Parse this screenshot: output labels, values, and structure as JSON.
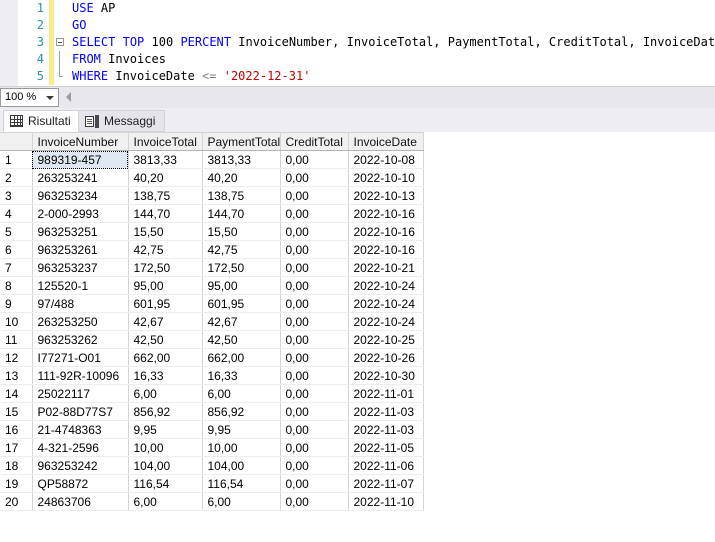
{
  "editor": {
    "zoom_level": "100 %",
    "lines": [
      {
        "number": "1",
        "tokens": [
          {
            "t": "USE",
            "c": "kw"
          },
          {
            "t": " ",
            "c": "punct"
          },
          {
            "t": "AP",
            "c": "id"
          }
        ]
      },
      {
        "number": "2",
        "tokens": [
          {
            "t": "GO",
            "c": "kw"
          }
        ]
      },
      {
        "number": "3",
        "tokens": [
          {
            "t": "SELECT",
            "c": "kw"
          },
          {
            "t": " ",
            "c": "punct"
          },
          {
            "t": "TOP",
            "c": "kw"
          },
          {
            "t": " ",
            "c": "punct"
          },
          {
            "t": "100",
            "c": "num"
          },
          {
            "t": " ",
            "c": "punct"
          },
          {
            "t": "PERCENT",
            "c": "kw"
          },
          {
            "t": " InvoiceNumber, InvoiceTotal, PaymentTotal, CreditTotal, InvoiceDate",
            "c": "id"
          }
        ]
      },
      {
        "number": "4",
        "tokens": [
          {
            "t": "FROM",
            "c": "kw"
          },
          {
            "t": " Invoices",
            "c": "id"
          }
        ]
      },
      {
        "number": "5",
        "tokens": [
          {
            "t": "WHERE",
            "c": "kw"
          },
          {
            "t": " InvoiceDate ",
            "c": "id"
          },
          {
            "t": "<=",
            "c": "op"
          },
          {
            "t": " ",
            "c": "punct"
          },
          {
            "t": "'2022-12-31'",
            "c": "str"
          }
        ]
      }
    ],
    "full_text": "USE AP\nGO\nSELECT TOP 100 PERCENT InvoiceNumber, InvoiceTotal, PaymentTotal, CreditTotal, InvoiceDate\nFROM Invoices\nWHERE InvoiceDate <= '2022-12-31'"
  },
  "tabs": [
    {
      "id": "risultati",
      "label": "Risultati",
      "icon": "grid-icon",
      "active": true
    },
    {
      "id": "messaggi",
      "label": "Messaggi",
      "icon": "message-icon",
      "active": false
    }
  ],
  "grid": {
    "columns": [
      "InvoiceNumber",
      "InvoiceTotal",
      "PaymentTotal",
      "CreditTotal",
      "InvoiceDate"
    ],
    "selected_cell": {
      "row": 1,
      "column": "InvoiceNumber"
    },
    "rows": [
      {
        "n": "1",
        "InvoiceNumber": "989319-457",
        "InvoiceTotal": "3813,33",
        "PaymentTotal": "3813,33",
        "CreditTotal": "0,00",
        "InvoiceDate": "2022-10-08"
      },
      {
        "n": "2",
        "InvoiceNumber": "263253241",
        "InvoiceTotal": "40,20",
        "PaymentTotal": "40,20",
        "CreditTotal": "0,00",
        "InvoiceDate": "2022-10-10"
      },
      {
        "n": "3",
        "InvoiceNumber": "963253234",
        "InvoiceTotal": "138,75",
        "PaymentTotal": "138,75",
        "CreditTotal": "0,00",
        "InvoiceDate": "2022-10-13"
      },
      {
        "n": "4",
        "InvoiceNumber": "2-000-2993",
        "InvoiceTotal": "144,70",
        "PaymentTotal": "144,70",
        "CreditTotal": "0,00",
        "InvoiceDate": "2022-10-16"
      },
      {
        "n": "5",
        "InvoiceNumber": "963253251",
        "InvoiceTotal": "15,50",
        "PaymentTotal": "15,50",
        "CreditTotal": "0,00",
        "InvoiceDate": "2022-10-16"
      },
      {
        "n": "6",
        "InvoiceNumber": "963253261",
        "InvoiceTotal": "42,75",
        "PaymentTotal": "42,75",
        "CreditTotal": "0,00",
        "InvoiceDate": "2022-10-16"
      },
      {
        "n": "7",
        "InvoiceNumber": "963253237",
        "InvoiceTotal": "172,50",
        "PaymentTotal": "172,50",
        "CreditTotal": "0,00",
        "InvoiceDate": "2022-10-21"
      },
      {
        "n": "8",
        "InvoiceNumber": "125520-1",
        "InvoiceTotal": "95,00",
        "PaymentTotal": "95,00",
        "CreditTotal": "0,00",
        "InvoiceDate": "2022-10-24"
      },
      {
        "n": "9",
        "InvoiceNumber": "97/488",
        "InvoiceTotal": "601,95",
        "PaymentTotal": "601,95",
        "CreditTotal": "0,00",
        "InvoiceDate": "2022-10-24"
      },
      {
        "n": "10",
        "InvoiceNumber": "263253250",
        "InvoiceTotal": "42,67",
        "PaymentTotal": "42,67",
        "CreditTotal": "0,00",
        "InvoiceDate": "2022-10-24"
      },
      {
        "n": "11",
        "InvoiceNumber": "963253262",
        "InvoiceTotal": "42,50",
        "PaymentTotal": "42,50",
        "CreditTotal": "0,00",
        "InvoiceDate": "2022-10-25"
      },
      {
        "n": "12",
        "InvoiceNumber": "I77271-O01",
        "InvoiceTotal": "662,00",
        "PaymentTotal": "662,00",
        "CreditTotal": "0,00",
        "InvoiceDate": "2022-10-26"
      },
      {
        "n": "13",
        "InvoiceNumber": "111-92R-10096",
        "InvoiceTotal": "16,33",
        "PaymentTotal": "16,33",
        "CreditTotal": "0,00",
        "InvoiceDate": "2022-10-30"
      },
      {
        "n": "14",
        "InvoiceNumber": "25022117",
        "InvoiceTotal": "6,00",
        "PaymentTotal": "6,00",
        "CreditTotal": "0,00",
        "InvoiceDate": "2022-11-01"
      },
      {
        "n": "15",
        "InvoiceNumber": "P02-88D77S7",
        "InvoiceTotal": "856,92",
        "PaymentTotal": "856,92",
        "CreditTotal": "0,00",
        "InvoiceDate": "2022-11-03"
      },
      {
        "n": "16",
        "InvoiceNumber": "21-4748363",
        "InvoiceTotal": "9,95",
        "PaymentTotal": "9,95",
        "CreditTotal": "0,00",
        "InvoiceDate": "2022-11-03"
      },
      {
        "n": "17",
        "InvoiceNumber": "4-321-2596",
        "InvoiceTotal": "10,00",
        "PaymentTotal": "10,00",
        "CreditTotal": "0,00",
        "InvoiceDate": "2022-11-05"
      },
      {
        "n": "18",
        "InvoiceNumber": "963253242",
        "InvoiceTotal": "104,00",
        "PaymentTotal": "104,00",
        "CreditTotal": "0,00",
        "InvoiceDate": "2022-11-06"
      },
      {
        "n": "19",
        "InvoiceNumber": "QP58872",
        "InvoiceTotal": "116,54",
        "PaymentTotal": "116,54",
        "CreditTotal": "0,00",
        "InvoiceDate": "2022-11-07"
      },
      {
        "n": "20",
        "InvoiceNumber": "24863706",
        "InvoiceTotal": "6,00",
        "PaymentTotal": "6,00",
        "CreditTotal": "0,00",
        "InvoiceDate": "2022-11-10"
      }
    ]
  },
  "colors": {
    "keyword": "#0000ff",
    "string": "#c00000",
    "operator": "#808080",
    "line_number": "#2b91af",
    "change_bar": "#fbe98b",
    "selection": "#dfe8f2"
  }
}
